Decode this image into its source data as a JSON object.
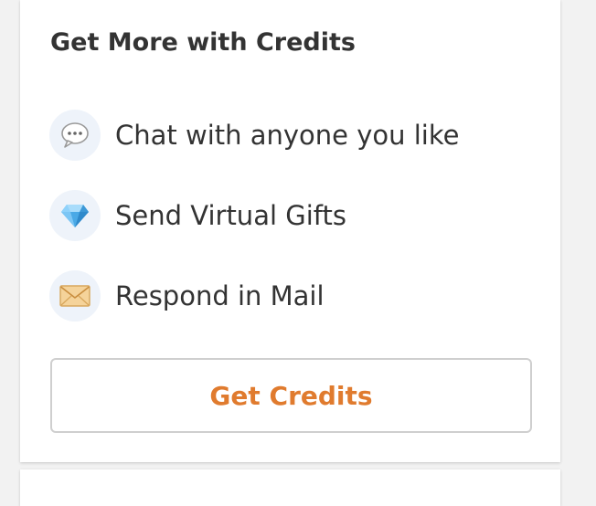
{
  "panel": {
    "title": "Get More with Credits",
    "features": [
      {
        "icon": "speech-bubble-icon",
        "label": "Chat with anyone you like"
      },
      {
        "icon": "gem-icon",
        "label": "Send Virtual Gifts"
      },
      {
        "icon": "envelope-icon",
        "label": "Respond in Mail"
      }
    ],
    "cta_label": "Get Credits"
  },
  "colors": {
    "accent": "#e07b2e",
    "text": "#333333",
    "icon_background": "#eef3fa",
    "page_background": "#f2f2f2"
  }
}
